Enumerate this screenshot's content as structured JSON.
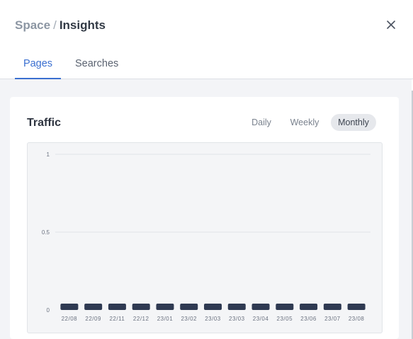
{
  "header": {
    "breadcrumb_parent": "Space",
    "breadcrumb_separator": "/",
    "breadcrumb_current": "Insights"
  },
  "tabs": [
    {
      "label": "Pages",
      "active": true
    },
    {
      "label": "Searches",
      "active": false
    }
  ],
  "card": {
    "title": "Traffic",
    "ranges": [
      {
        "label": "Daily",
        "active": false
      },
      {
        "label": "Weekly",
        "active": false
      },
      {
        "label": "Monthly",
        "active": true
      }
    ]
  },
  "chart_data": {
    "type": "bar",
    "categories": [
      "22/08",
      "22/09",
      "22/11",
      "22/12",
      "23/01",
      "23/02",
      "23/03",
      "23/03",
      "23/04",
      "23/05",
      "23/06",
      "23/07",
      "23/08"
    ],
    "values": [
      0,
      0,
      0,
      0,
      0,
      0,
      0,
      0,
      0,
      0,
      0,
      0,
      0
    ],
    "ylim": [
      0,
      1
    ],
    "yticks": [
      "1",
      "0.5",
      "0"
    ],
    "grid": true,
    "bar_color": "#2f3a52"
  }
}
